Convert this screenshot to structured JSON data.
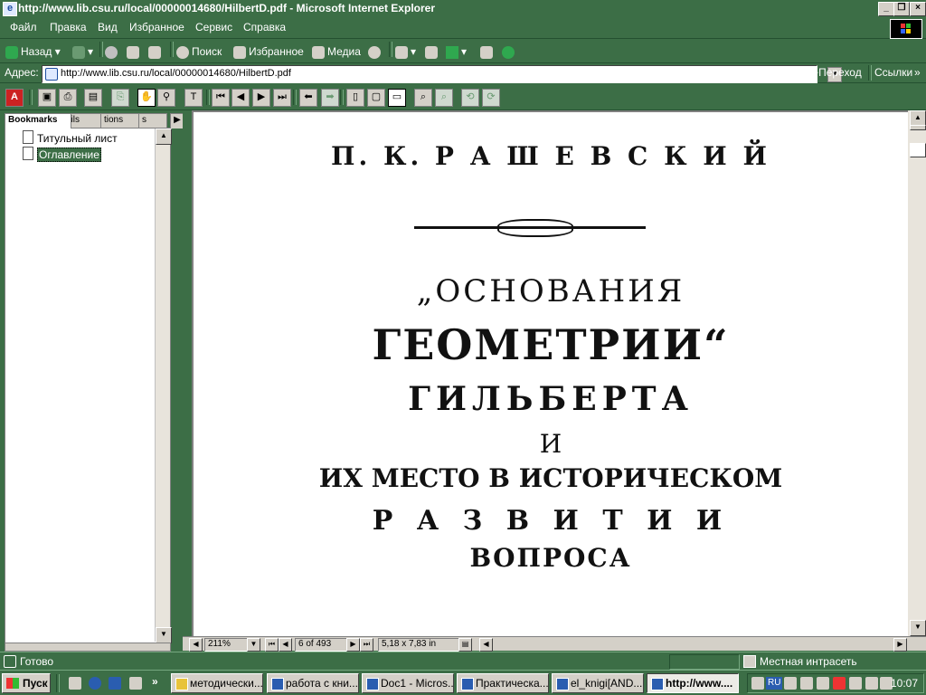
{
  "window": {
    "title": "http://www.lib.csu.ru/local/00000014680/HilbertD.pdf - Microsoft Internet Explorer"
  },
  "menubar": {
    "items": [
      "Файл",
      "Правка",
      "Вид",
      "Избранное",
      "Сервис",
      "Справка"
    ]
  },
  "toolbar": {
    "back_label": "Назад",
    "search_label": "Поиск",
    "favorites_label": "Избранное",
    "media_label": "Медиа"
  },
  "address": {
    "label": "Адрес:",
    "url": "http://www.lib.csu.ru/local/00000014680/HilbertD.pdf",
    "go_label": "Переход",
    "links_label": "Ссылки"
  },
  "bookmarks_panel": {
    "tabs": [
      "Bookmarks",
      "ails",
      "tions",
      "s"
    ],
    "items": [
      {
        "label": "Титульный лист",
        "selected": false
      },
      {
        "label": "Оглавление",
        "selected": true
      }
    ]
  },
  "document": {
    "author": "П. К. Р А Ш Е В С К И Й",
    "title_line1": "„ОСНОВАНИЯ",
    "title_line2": "ГЕОМЕТРИИ“",
    "title_line3": "ГИЛЬБЕРТА",
    "title_line4": "И",
    "title_line5": "ИХ МЕСТО В ИСТОРИЧЕСКОМ",
    "title_line6": "Р А З В И Т И И",
    "title_line7": "ВОПРОСА"
  },
  "doc_status": {
    "zoom": "211%",
    "page": "6 of 493",
    "page_size": "5,18 x 7,83 in"
  },
  "ie_status": {
    "text": "Готово",
    "zone": "Местная интрасеть"
  },
  "taskbar": {
    "start_label": "Пуск",
    "tasks": [
      {
        "label": "методически...",
        "active": false
      },
      {
        "label": "работа с кни...",
        "active": false
      },
      {
        "label": "Doc1 - Micros...",
        "active": false
      },
      {
        "label": "Практическа...",
        "active": false
      },
      {
        "label": "el_knigi[AND...",
        "active": false
      },
      {
        "label": "http://www....",
        "active": true
      }
    ],
    "lang": "RU",
    "clock": "10:07"
  },
  "colors": {
    "chrome": "#3c6e46",
    "selection": "#3c6e46"
  }
}
